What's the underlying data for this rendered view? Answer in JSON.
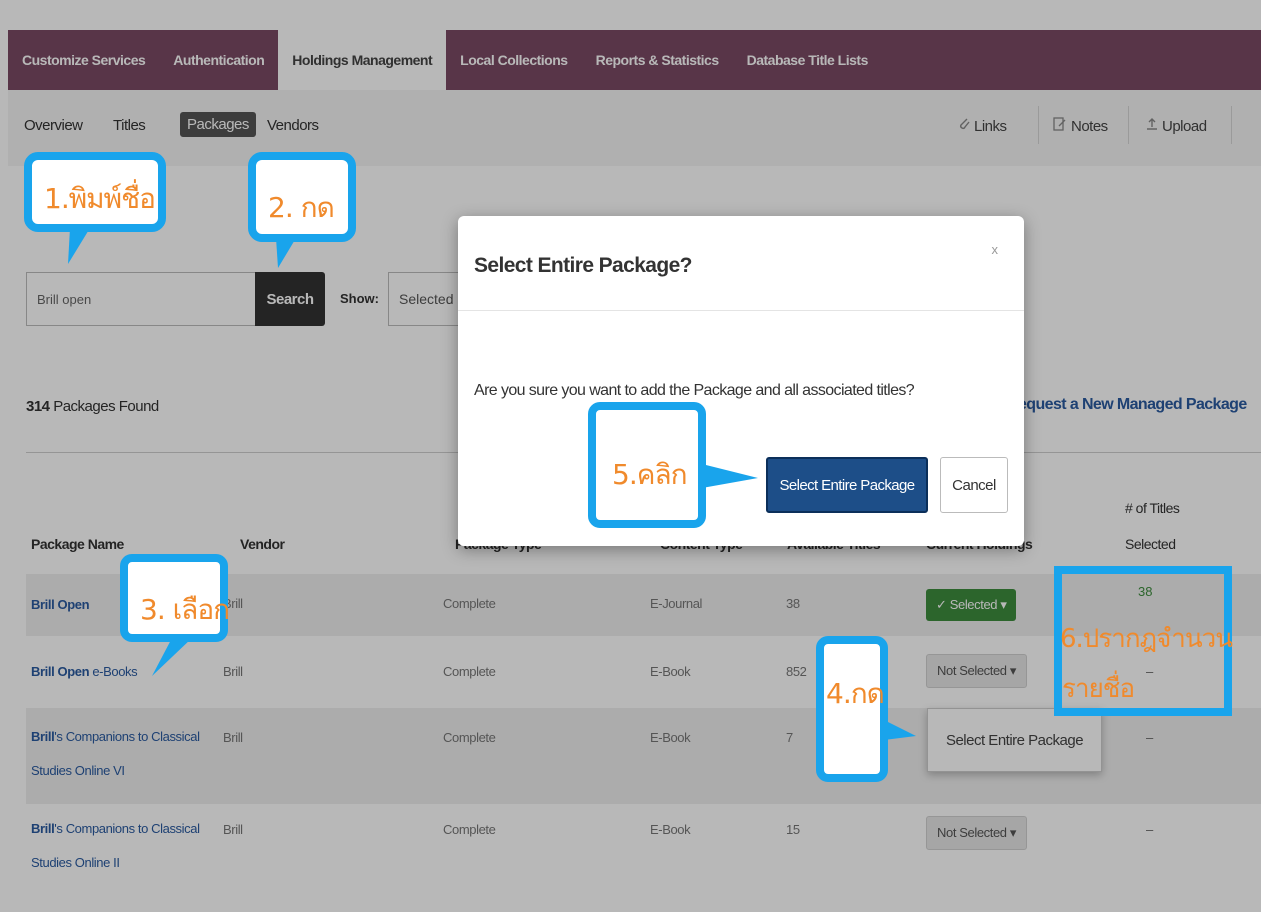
{
  "main_nav": {
    "tabs": [
      {
        "label": "Customize Services",
        "active": false
      },
      {
        "label": "Authentication",
        "active": false
      },
      {
        "label": "Holdings Management",
        "active": true
      },
      {
        "label": "Local Collections",
        "active": false
      },
      {
        "label": "Reports & Statistics",
        "active": false
      },
      {
        "label": "Database Title Lists",
        "active": false
      }
    ]
  },
  "sub_nav": {
    "items": [
      "Overview",
      "Titles",
      "Packages",
      "Vendors"
    ],
    "active": "Packages",
    "tools": [
      {
        "label": "Links",
        "icon": "paperclip-icon"
      },
      {
        "label": "Notes",
        "icon": "note-icon"
      },
      {
        "label": "Upload",
        "icon": "upload-icon"
      }
    ]
  },
  "search": {
    "value": "Brill open",
    "button_label": "Search",
    "show_label": "Show:",
    "show_value": "Selected"
  },
  "results": {
    "count": "314",
    "count_suffix": "Packages Found",
    "request_link": "equest a New Managed Package"
  },
  "table": {
    "headers": {
      "package_name": "Package Name",
      "vendor": "Vendor",
      "package_type": "Package Type",
      "content_type": "Content Type",
      "available_titles": "Available Titles",
      "current_holdings": "Current Holdings",
      "titles_selected_line1": "# of Titles",
      "titles_selected_line2": "Selected"
    },
    "rows": [
      {
        "name_bold": "Brill Open",
        "name_rest": "",
        "name_line2": "",
        "vendor": "Brill",
        "package_type": "Complete",
        "content_type": "E-Journal",
        "available": "38",
        "holdings": "Selected",
        "titles_selected": "38"
      },
      {
        "name_bold": "Brill Open",
        "name_rest": " e-Books",
        "name_line2": "",
        "vendor": "Brill",
        "package_type": "Complete",
        "content_type": "E-Book",
        "available": "852",
        "holdings": "Not Selected",
        "titles_selected": "–"
      },
      {
        "name_bold": "Brill",
        "name_rest": "'s Companions to Classical",
        "name_line2": "Studies Online VI",
        "vendor": "Brill",
        "package_type": "Complete",
        "content_type": "E-Book",
        "available": "7",
        "holdings": "",
        "titles_selected": "–"
      },
      {
        "name_bold": "Brill",
        "name_rest": "'s Companions to Classical",
        "name_line2": "Studies Online II",
        "vendor": "Brill",
        "package_type": "Complete",
        "content_type": "E-Book",
        "available": "15",
        "holdings": "Not Selected",
        "titles_selected": "–"
      }
    ],
    "dropdown_item": "Select Entire Package"
  },
  "modal": {
    "title": "Select Entire Package?",
    "close": "x",
    "body": "Are you sure you want to add the Package and all associated titles?",
    "primary_button": "Select Entire Package",
    "cancel_button": "Cancel"
  },
  "annotations": {
    "step1": "1.พิมพ์ชื่อ",
    "step2": "2. กด",
    "step3": "3. เลือก",
    "step4": "4.กด",
    "step5": "5.คลิก",
    "step6_line1": "6.ปรากฎจำนวน",
    "step6_line2": "รายชื่อ",
    "color": "#19a4ec",
    "text_color": "#f08a2c"
  },
  "colors": {
    "nav_bg": "#7a4a64",
    "link_blue": "#2a5aa0",
    "selected_green": "#3d8c3d",
    "primary_button": "#1d4e88"
  }
}
